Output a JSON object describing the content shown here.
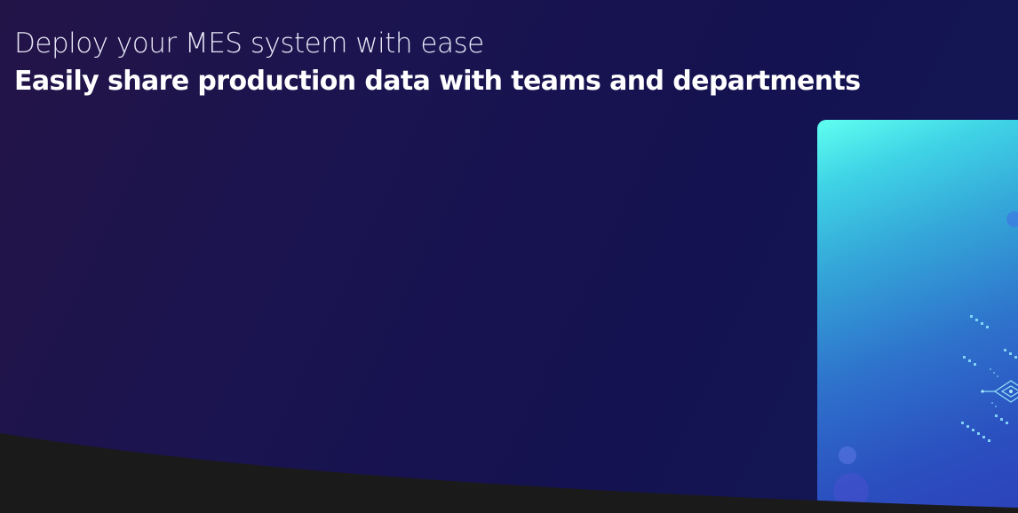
{
  "hero": {
    "subtitle": "Deploy your MES system with ease",
    "title": "Easily share production data with teams and departments"
  },
  "image": {
    "icon": "circuit-board-illustration"
  },
  "colors": {
    "background": "#161250",
    "footer": "#1a1a1a",
    "image_accent": "#5ffff0",
    "text": "#ffffff"
  }
}
